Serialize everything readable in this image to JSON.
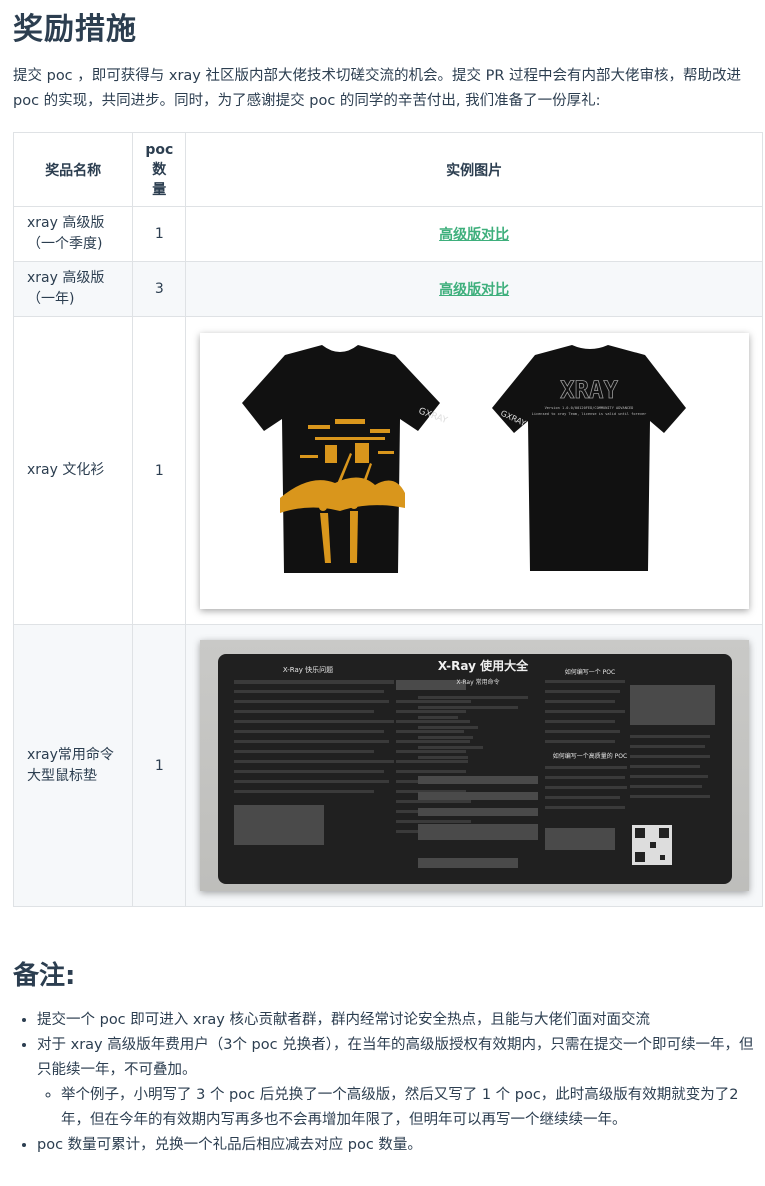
{
  "title": "奖励措施",
  "intro": "提交 poc ，即可获得与 xray 社区版内部大佬技术切磋交流的机会。提交 PR 过程中会有内部大佬审核，帮助改进 poc 的实现，共同进步。同时，为了感谢提交 poc 的同学的辛苦付出, 我们准备了一份厚礼:",
  "table": {
    "headers": {
      "name": "奖品名称",
      "count_line1": "poc",
      "count_line2": "数",
      "count_line3": "量",
      "image": "实例图片"
    },
    "rows": [
      {
        "name_line1": "xray 高级版",
        "name_line2": "（一个季度)",
        "count": "1",
        "link": "高级版对比"
      },
      {
        "name_line1": "xray 高级版",
        "name_line2": "（一年)",
        "count": "3",
        "link": "高级版对比"
      },
      {
        "name_line1": "xray 文化衫",
        "count": "1"
      },
      {
        "name_line1": "xray常用命令",
        "name_line2": "大型鼠标垫",
        "count": "1"
      }
    ]
  },
  "shirt": {
    "back_logo": "XRAY",
    "back_line1": "Version 1.0.0/00120FED/COMMUNITY ADVANCED",
    "back_line2": "Licensed to xray Team, license is valid until forever",
    "sleeve_text": "GXRAY"
  },
  "mousepad": {
    "col1_title": "X-Ray 快乐问题",
    "center_title": "X-Ray 使用大全",
    "center_subtitle": "X-Ray 常用命令",
    "col3_title": "如何编写一个 POC",
    "col3_subtitle": "如何编写一个高质量的 POC"
  },
  "notes_title": "备注:",
  "notes": {
    "item1": "提交一个 poc 即可进入 xray 核心贡献者群，群内经常讨论安全热点，且能与大佬们面对面交流",
    "item2": "对于 xray 高级版年费用户（3个 poc 兑换者），在当年的高级版授权有效期内，只需在提交一个即可续一年，但只能续一年，不可叠加。",
    "item2_sub": "举个例子，小明写了 3 个 poc 后兑换了一个高级版，然后又写了 1 个 poc，此时高级版有效期就变为了2 年，但在今年的有效期内写再多也不会再增加年限了，但明年可以再写一个继续续一年。",
    "item3": "poc 数量可累计，兑换一个礼品后相应减去对应 poc 数量。"
  },
  "colors": {
    "text": "#2c3e50",
    "link": "#3eaf7c",
    "border": "#dfe2e5",
    "alt_row": "#f6f8fa"
  }
}
